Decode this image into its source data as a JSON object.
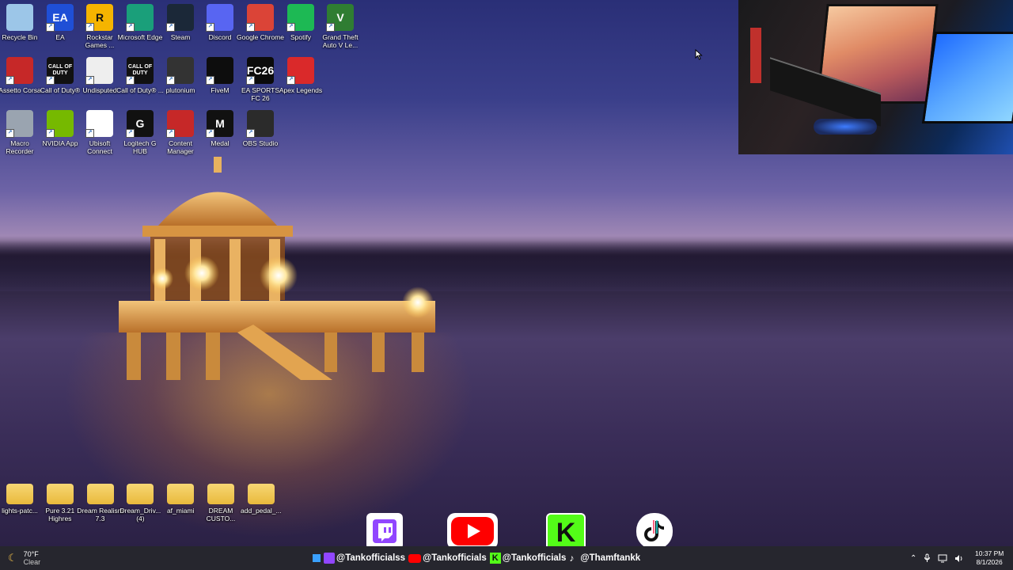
{
  "desktop": {
    "icons": [
      {
        "label": "Recycle Bin",
        "icon": "recycle-bin-icon",
        "color": "#9cc6e8"
      },
      {
        "label": "EA",
        "icon": "ea-icon",
        "color": "#1f4fd6",
        "text": "EA"
      },
      {
        "label": "Rockstar Games ...",
        "icon": "rockstar-icon",
        "color": "#f5b400",
        "text": "R"
      },
      {
        "label": "Microsoft Edge",
        "icon": "edge-icon",
        "color": "#1a9f7a"
      },
      {
        "label": "Steam",
        "icon": "steam-icon",
        "color": "#1b2838"
      },
      {
        "label": "Discord",
        "icon": "discord-icon",
        "color": "#5865f2"
      },
      {
        "label": "Google Chrome",
        "icon": "chrome-icon",
        "color": "#db4437"
      },
      {
        "label": "Spotify",
        "icon": "spotify-icon",
        "color": "#1db954"
      },
      {
        "label": "Grand Theft Auto V Le...",
        "icon": "gta-icon",
        "color": "#2f7d32",
        "text": "V"
      },
      {
        "label": "Assetto Corsa",
        "icon": "assetto-corsa-icon",
        "color": "#c62828"
      },
      {
        "label": "Call of Duty®",
        "icon": "call-of-duty-icon",
        "color": "#111111",
        "text": "CALL OF DUTY"
      },
      {
        "label": "Undisputed",
        "icon": "undisputed-icon",
        "color": "#eeeeee"
      },
      {
        "label": "Call of Duty® ...",
        "icon": "call-of-duty-icon",
        "color": "#111111",
        "text": "CALL OF DUTY"
      },
      {
        "label": "plutonium",
        "icon": "plutonium-icon",
        "color": "#333333"
      },
      {
        "label": "FiveM",
        "icon": "fivem-icon",
        "color": "#0d0d0d"
      },
      {
        "label": "EA SPORTS FC 26",
        "icon": "ea-fc-icon",
        "color": "#0b0b0b",
        "text": "FC26"
      },
      {
        "label": "Apex Legends",
        "icon": "apex-legends-icon",
        "color": "#da292a"
      },
      {
        "label": "Macro Recorder",
        "icon": "macro-recorder-icon",
        "color": "#9aa4b0"
      },
      {
        "label": "NVIDIA App",
        "icon": "nvidia-icon",
        "color": "#76b900"
      },
      {
        "label": "Ubisoft Connect",
        "icon": "ubisoft-icon",
        "color": "#ffffff"
      },
      {
        "label": "Logitech G HUB",
        "icon": "logitech-icon",
        "color": "#111111",
        "text": "G"
      },
      {
        "label": "Content Manager",
        "icon": "content-manager-icon",
        "color": "#c62828"
      },
      {
        "label": "Medal",
        "icon": "medal-icon",
        "color": "#111111",
        "text": "M"
      },
      {
        "label": "OBS Studio",
        "icon": "obs-icon",
        "color": "#2b2b2b"
      }
    ],
    "folders": [
      {
        "label": "lights-patc...",
        "icon": "folder-icon"
      },
      {
        "label": "Pure 3.21 Highres",
        "icon": "folder-icon"
      },
      {
        "label": "Dream Realism 7.3",
        "icon": "folder-icon"
      },
      {
        "label": "Dream_Driv... (4)",
        "icon": "folder-icon"
      },
      {
        "label": "af_miami",
        "icon": "folder-icon"
      },
      {
        "label": "DREAM CUSTO...",
        "icon": "folder-icon"
      },
      {
        "label": "add_pedal_...",
        "icon": "folder-icon"
      }
    ]
  },
  "overlay": {
    "handles": [
      "@Tankofficialss",
      "@Tankofficials",
      "@Tankofficials",
      "@Thamftankk"
    ],
    "handle_icons": [
      "twitch-icon",
      "youtube-icon",
      "kick-icon",
      "tiktok-icon"
    ],
    "brand_colors": {
      "twitch": "#9146ff",
      "youtube": "#ff0000",
      "kick": "#53fc18",
      "tiktok": "#111111"
    }
  },
  "taskbar": {
    "weather_temp": "70°F",
    "weather_desc": "Clear",
    "time": "10:37 PM",
    "date": "8/1/2026"
  }
}
